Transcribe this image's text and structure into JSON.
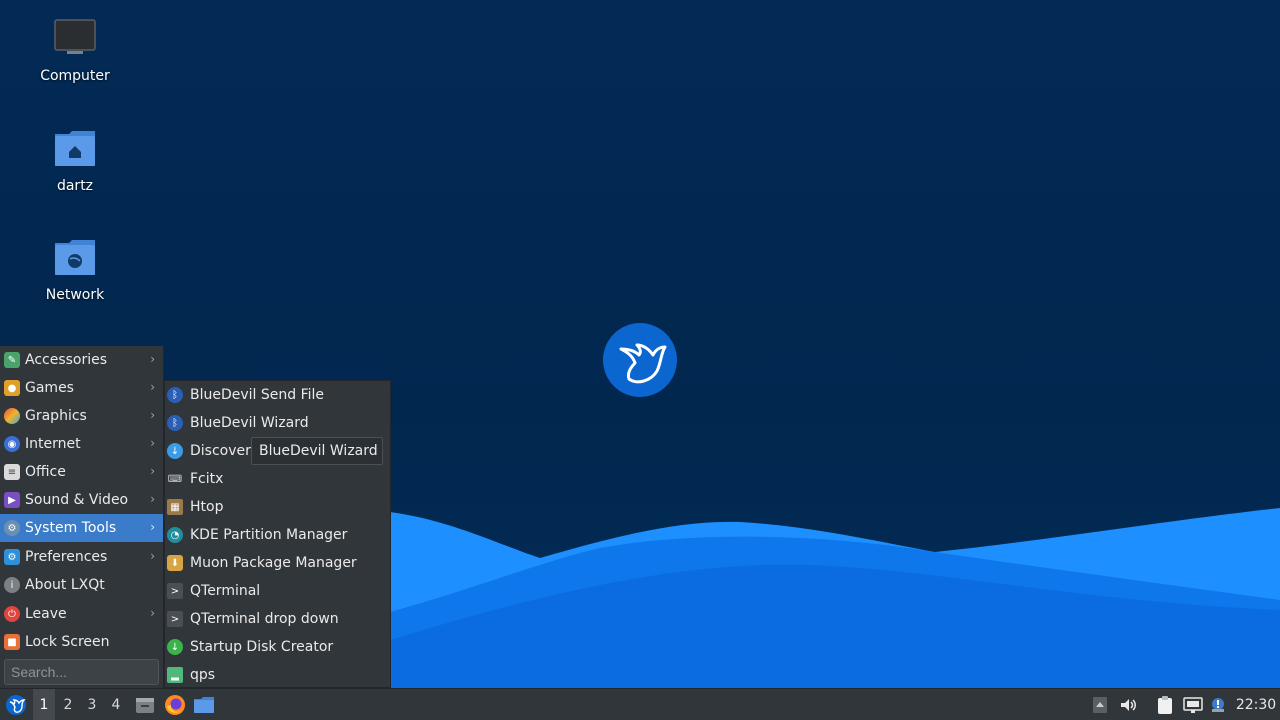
{
  "desktop": {
    "icons": [
      {
        "label": "Computer"
      },
      {
        "label": "dartz"
      },
      {
        "label": "Network"
      }
    ],
    "wallpaper_colors": {
      "background": "#02274f",
      "wave_light": "#1e8fff",
      "wave_dark": "#0a64d8"
    }
  },
  "main_menu": {
    "items": [
      {
        "label": "Accessories",
        "icon": "accessories-icon",
        "has_submenu": true
      },
      {
        "label": "Games",
        "icon": "games-icon",
        "has_submenu": true
      },
      {
        "label": "Graphics",
        "icon": "graphics-icon",
        "has_submenu": true
      },
      {
        "label": "Internet",
        "icon": "internet-icon",
        "has_submenu": true
      },
      {
        "label": "Office",
        "icon": "office-icon",
        "has_submenu": true
      },
      {
        "label": "Sound & Video",
        "icon": "sound-video-icon",
        "has_submenu": true
      },
      {
        "label": "System Tools",
        "icon": "system-tools-icon",
        "has_submenu": true,
        "active": true
      },
      {
        "label": "Preferences",
        "icon": "preferences-icon",
        "has_submenu": true
      },
      {
        "label": "About LXQt",
        "icon": "info-icon",
        "has_submenu": false
      },
      {
        "label": "Leave",
        "icon": "power-icon",
        "has_submenu": true
      },
      {
        "label": "Lock Screen",
        "icon": "lock-icon",
        "has_submenu": false
      }
    ],
    "arrow": "›",
    "search_placeholder": "Search...",
    "accent": "#3a7cc9"
  },
  "sub_menu": {
    "items": [
      {
        "label": "BlueDevil Send File",
        "icon": "bluetooth-icon"
      },
      {
        "label": "BlueDevil Wizard",
        "icon": "bluetooth-icon"
      },
      {
        "label": "Discover",
        "icon": "discover-icon"
      },
      {
        "label": "Fcitx",
        "icon": "keyboard-icon"
      },
      {
        "label": "Htop",
        "icon": "htop-icon"
      },
      {
        "label": "KDE Partition Manager",
        "icon": "partition-manager-icon"
      },
      {
        "label": "Muon Package Manager",
        "icon": "package-manager-icon"
      },
      {
        "label": "QTerminal",
        "icon": "terminal-icon"
      },
      {
        "label": "QTerminal drop down",
        "icon": "terminal-icon"
      },
      {
        "label": "Startup Disk Creator",
        "icon": "startup-disk-icon"
      },
      {
        "label": "qps",
        "icon": "qps-icon"
      }
    ]
  },
  "tooltip": {
    "text": "BlueDevil Wizard"
  },
  "taskbar": {
    "workspaces": [
      "1",
      "2",
      "3",
      "4"
    ],
    "active_workspace": "1",
    "clock": "22:30"
  }
}
